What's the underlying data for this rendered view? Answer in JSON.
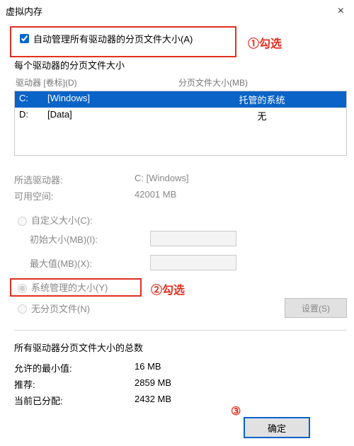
{
  "title": "虚拟内存",
  "auto_manage": {
    "label": "自动管理所有驱动器的分页文件大小(A)",
    "checked": true
  },
  "annotations": {
    "a1": "①勾选",
    "a2": "②勾选",
    "a3": "③"
  },
  "per_drive_title": "每个驱动器的分页文件大小",
  "drive_header": {
    "drive": "驱动器 [卷标](D)",
    "pf": "分页文件大小(MB)"
  },
  "drives": [
    {
      "letter": "C:",
      "name": "[Windows]",
      "pf": "托管的系统",
      "selected": true
    },
    {
      "letter": "D:",
      "name": "[Data]",
      "pf": "无",
      "selected": false
    }
  ],
  "selected_info": {
    "drive_k": "所选驱动器:",
    "drive_v": "C:  [Windows]",
    "space_k": "可用空间:",
    "space_v": "42001 MB"
  },
  "radios": {
    "custom": "自定义大小(C):",
    "initial": "初始大小(MB)(I):",
    "max": "最大值(MB)(X):",
    "system": "系统管理的大小(Y)",
    "none": "无分页文件(N)"
  },
  "set_btn": "设置(S)",
  "totals_title": "所有驱动器分页文件大小的总数",
  "totals": {
    "min_k": "允许的最小值:",
    "min_v": "16 MB",
    "rec_k": "推荐:",
    "rec_v": "2859 MB",
    "cur_k": "当前已分配:",
    "cur_v": "2432 MB"
  },
  "ok": "确定"
}
